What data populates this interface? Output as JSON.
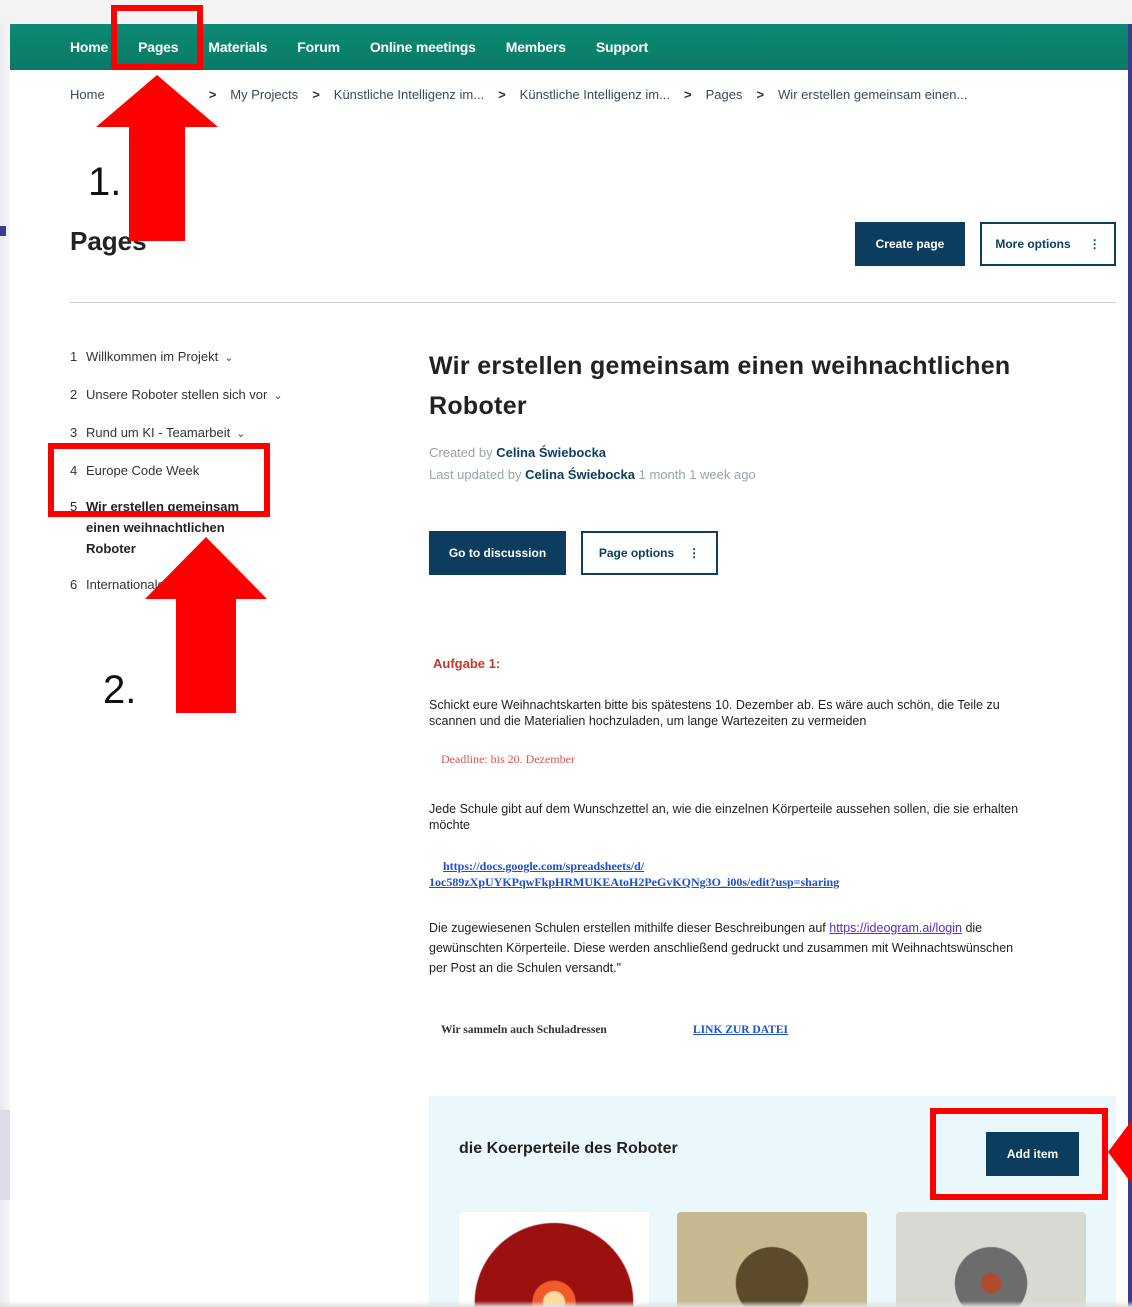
{
  "topnav": {
    "items": [
      "Home",
      "Pages",
      "Materials",
      "Forum",
      "Online meetings",
      "Members",
      "Support"
    ]
  },
  "breadcrumb": {
    "home": "Home",
    "items": [
      "My Projects",
      "Künstliche Intelligenz im...",
      "Künstliche Intelligenz im...",
      "Pages",
      "Wir erstellen gemeinsam einen..."
    ],
    "separator": ">"
  },
  "header": {
    "title": "Pages",
    "create_label": "Create page",
    "more_label": "More options",
    "more_icon": "⋮"
  },
  "sidebar": {
    "items": [
      {
        "num": "1",
        "label": "Willkommen im Projekt",
        "has_chevron": true
      },
      {
        "num": "2",
        "label": "Unsere Roboter stellen sich vor",
        "has_chevron": true
      },
      {
        "num": "3",
        "label": "Rund um KI - Teamarbeit",
        "has_chevron": true
      },
      {
        "num": "4",
        "label": "Europe Code Week",
        "has_chevron": false
      },
      {
        "num": "5",
        "label": "Wir erstellen gemeinsam einen weihnachtlichen Roboter",
        "has_chevron": false,
        "active": true
      },
      {
        "num": "6",
        "label": "Internationale ...",
        "has_chevron": true
      }
    ],
    "chevron": "⌄"
  },
  "main": {
    "title": "Wir erstellen gemeinsam einen weihnachtlichen Roboter",
    "created_prefix": "Created by",
    "created_by": "Celina Świebocka",
    "updated_prefix": "Last updated by",
    "updated_by": "Celina Świebocka",
    "updated_ago": "1 month 1 week ago",
    "discuss_label": "Go to discussion",
    "page_options_label": "Page options",
    "page_options_icon": "⋮"
  },
  "content": {
    "aufgabe": "Aufgabe 1:",
    "para1": "Schickt eure Weihnachtskarten bitte bis spätestens 10. Dezember ab. Es wäre auch schön, die Teile zu scannen und die Materialien hochzuladen, um lange Wartezeiten zu vermeiden",
    "deadline": "Deadline: bis 20. Dezember",
    "para2": "Jede Schule gibt auf dem Wunschzettel an, wie die einzelnen Körperteile aussehen sollen, die sie erhalten möchte",
    "gdoc_line1": "https://docs.google.com/spreadsheets/d/",
    "gdoc_line2": "1oc589zXpUYKPqwFkpHRMUKEAtoH2PeGvKQNg3O_i00s/edit?usp=sharing",
    "para3_before": "Die zugewiesenen Schulen erstellen mithilfe dieser Beschreibungen auf ",
    "ideogram_link": "https://ideogram.ai/login",
    "para3_after": " die gewünschten Körperteile. Diese werden anschließend gedruckt und zusammen mit Weihnachtswünschen per Post an die Schulen versandt.\"",
    "wir_sammeln": "Wir sammeln auch Schuladressen",
    "link_datei": "LINK ZUR DATEI"
  },
  "panel": {
    "title": "die Koerperteile des Roboter",
    "add_label": "Add item"
  },
  "annotations": {
    "label1": "1.",
    "label2": "2.",
    "color": "#ff0000"
  },
  "colors": {
    "nav_green": "#0a7a66",
    "primary": "#0c3d5e",
    "panel_bg": "#eaf8fb"
  }
}
